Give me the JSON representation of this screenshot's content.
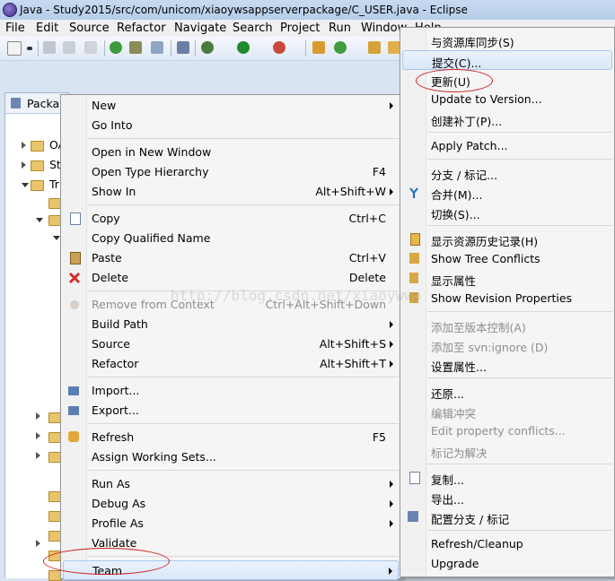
{
  "window": {
    "title": "Java - Study2015/src/com/unicom/xiaoywsappserverpackage/C_USER.java - Eclipse"
  },
  "menubar": {
    "items": [
      "File",
      "Edit",
      "Source",
      "Refactor",
      "Navigate",
      "Search",
      "Project",
      "Run",
      "Window",
      "Help"
    ]
  },
  "explorer": {
    "tab_label": "Package Explorer",
    "tree": [
      {
        "text": "OA"
      },
      {
        "text": "Study"
      },
      {
        "text": "Tr"
      }
    ]
  },
  "context_menu": {
    "items": [
      {
        "label": "New",
        "accel": "",
        "submenu": true
      },
      {
        "label": "Go Into",
        "accel": ""
      },
      {
        "sep": true
      },
      {
        "label": "Open in New Window",
        "accel": ""
      },
      {
        "label": "Open Type Hierarchy",
        "accel": "F4"
      },
      {
        "label": "Show In",
        "accel": "Alt+Shift+W",
        "submenu": true
      },
      {
        "sep": true
      },
      {
        "label": "Copy",
        "accel": "Ctrl+C",
        "icon": "copy-icon"
      },
      {
        "label": "Copy Qualified Name",
        "accel": ""
      },
      {
        "label": "Paste",
        "accel": "Ctrl+V",
        "icon": "paste-icon"
      },
      {
        "label": "Delete",
        "accel": "Delete",
        "icon": "delete-icon"
      },
      {
        "sep": true
      },
      {
        "label": "Remove from Context",
        "accel": "Ctrl+Alt+Shift+Down",
        "disabled": true,
        "icon": "remove-context-icon"
      },
      {
        "label": "Build Path",
        "accel": "",
        "submenu": true
      },
      {
        "label": "Source",
        "accel": "Alt+Shift+S",
        "submenu": true
      },
      {
        "label": "Refactor",
        "accel": "Alt+Shift+T",
        "submenu": true
      },
      {
        "sep": true
      },
      {
        "label": "Import...",
        "accel": "",
        "icon": "import-icon"
      },
      {
        "label": "Export...",
        "accel": "",
        "icon": "export-icon"
      },
      {
        "sep": true
      },
      {
        "label": "Refresh",
        "accel": "F5",
        "icon": "refresh-icon"
      },
      {
        "label": "Assign Working Sets...",
        "accel": ""
      },
      {
        "sep": true
      },
      {
        "label": "Run As",
        "accel": "",
        "submenu": true
      },
      {
        "label": "Debug As",
        "accel": "",
        "submenu": true
      },
      {
        "label": "Profile As",
        "accel": "",
        "submenu": true
      },
      {
        "label": "Validate",
        "accel": ""
      },
      {
        "sep": true
      },
      {
        "label": "Team",
        "accel": "",
        "submenu": true,
        "highlight": true
      }
    ]
  },
  "team_menu": {
    "items": [
      {
        "label": "与资源库同步(S)"
      },
      {
        "label": "提交(C)...",
        "highlight": true
      },
      {
        "label": "更新(U)"
      },
      {
        "label": "Update to Version..."
      },
      {
        "label": "创建补丁(P)..."
      },
      {
        "sep": true
      },
      {
        "label": "Apply Patch..."
      },
      {
        "sep": true
      },
      {
        "label": "分支 / 标记..."
      },
      {
        "label": "合并(M)...",
        "icon": "merge-icon"
      },
      {
        "label": "切换(S)..."
      },
      {
        "sep": true
      },
      {
        "label": "显示资源历史记录(H)",
        "icon": "history-icon"
      },
      {
        "label": "Show Tree Conflicts",
        "icon": "tree-conflicts-icon"
      },
      {
        "label": "显示属性",
        "icon": "properties-icon"
      },
      {
        "label": "Show Revision Properties",
        "icon": "revision-properties-icon"
      },
      {
        "sep": true
      },
      {
        "label": "添加至版本控制(A)",
        "disabled": true
      },
      {
        "label": "添加至 svn:ignore (D)",
        "disabled": true
      },
      {
        "label": "设置属性..."
      },
      {
        "sep": true
      },
      {
        "label": "还原..."
      },
      {
        "label": "编辑冲突",
        "disabled": true
      },
      {
        "label": "Edit property conflicts...",
        "disabled": true
      },
      {
        "label": "标记为解决",
        "disabled": true
      },
      {
        "sep": true
      },
      {
        "label": "复制...",
        "icon": "copy-icon"
      },
      {
        "label": "导出..."
      },
      {
        "label": "配置分支 / 标记",
        "icon": "branch-config-icon"
      },
      {
        "sep": true
      },
      {
        "label": "Refresh/Cleanup"
      },
      {
        "label": "Upgrade"
      }
    ]
  },
  "watermark": "http://blog.csdn.net/xiaoywwp"
}
